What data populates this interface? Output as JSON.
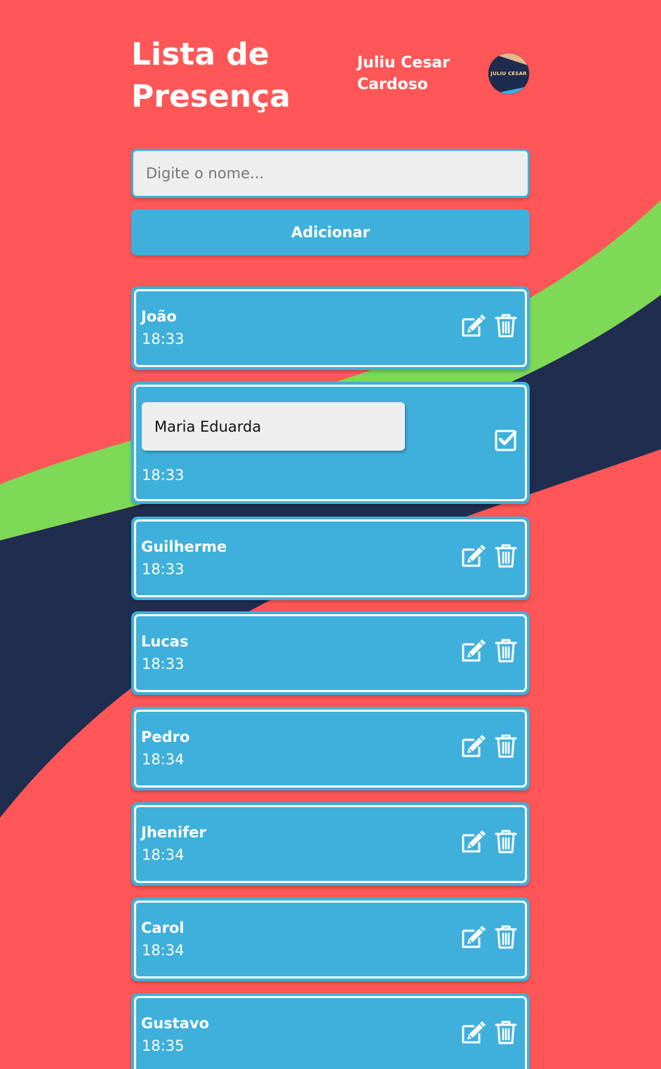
{
  "header": {
    "title": "Lista de Presença",
    "user_name": "Juliu Cesar Cardoso",
    "avatar_text": "JULIU CESAR"
  },
  "form": {
    "placeholder": "Digite o nome...",
    "value": "",
    "add_label": "Adicionar"
  },
  "colors": {
    "background": "#ff5757",
    "accent": "#3eb0db",
    "wave_green": "#7ed957",
    "wave_navy": "#1f2d4f"
  },
  "items": [
    {
      "name": "João",
      "time": "18:33",
      "editing": false
    },
    {
      "name": "Maria Eduarda",
      "time": "18:33",
      "editing": true
    },
    {
      "name": "Guilherme",
      "time": "18:33",
      "editing": false
    },
    {
      "name": "Lucas",
      "time": "18:33",
      "editing": false
    },
    {
      "name": "Pedro",
      "time": "18:34",
      "editing": false
    },
    {
      "name": "Jhenifer",
      "time": "18:34",
      "editing": false
    },
    {
      "name": "Carol",
      "time": "18:34",
      "editing": false
    },
    {
      "name": "Gustavo",
      "time": "18:35",
      "editing": false
    }
  ],
  "icons": {
    "edit": "edit-icon",
    "delete": "trash-icon",
    "confirm": "check-square-icon"
  }
}
